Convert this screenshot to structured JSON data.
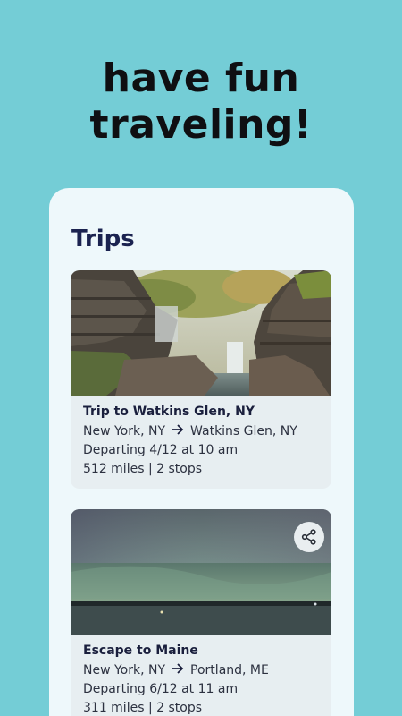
{
  "headline": {
    "line1": "have fun",
    "line2": "traveling!"
  },
  "screen": {
    "title": "Trips"
  },
  "trips": [
    {
      "title": "Trip to Watkins Glen, NY",
      "from": "New York, NY",
      "to": "Watkins Glen, NY",
      "departing": "Departing 4/12 at 10 am",
      "stats": "512 miles | 2 stops",
      "image": "waterfall-gorge-photo"
    },
    {
      "title": "Escape to Maine",
      "from": "New York, NY",
      "to": "Portland, ME",
      "departing": "Departing 6/12 at 11 am",
      "stats": "311 miles | 2 stops",
      "image": "northern-lights-lake-photo",
      "share_icon": "share-icon"
    }
  ],
  "colors": {
    "background": "#74cdd6",
    "card_panel": "#eef8fb",
    "title": "#1b2350"
  }
}
